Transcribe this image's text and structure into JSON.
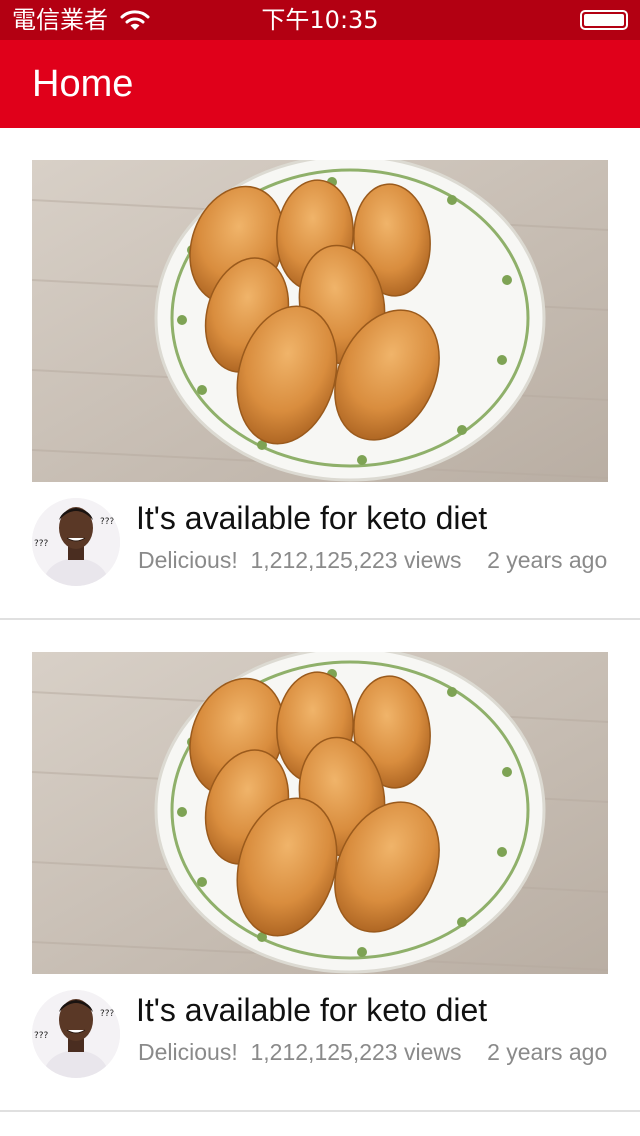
{
  "status_bar": {
    "carrier": "電信業者",
    "time": "下午10:35"
  },
  "nav": {
    "title": "Home"
  },
  "feed": [
    {
      "title": "It's available for keto diet",
      "channel": "Delicious!",
      "views": "1,212,125,223 views",
      "age": "2 years ago"
    },
    {
      "title": "It's available for keto diet",
      "channel": "Delicious!",
      "views": "1,212,125,223 views",
      "age": "2 years ago"
    }
  ]
}
